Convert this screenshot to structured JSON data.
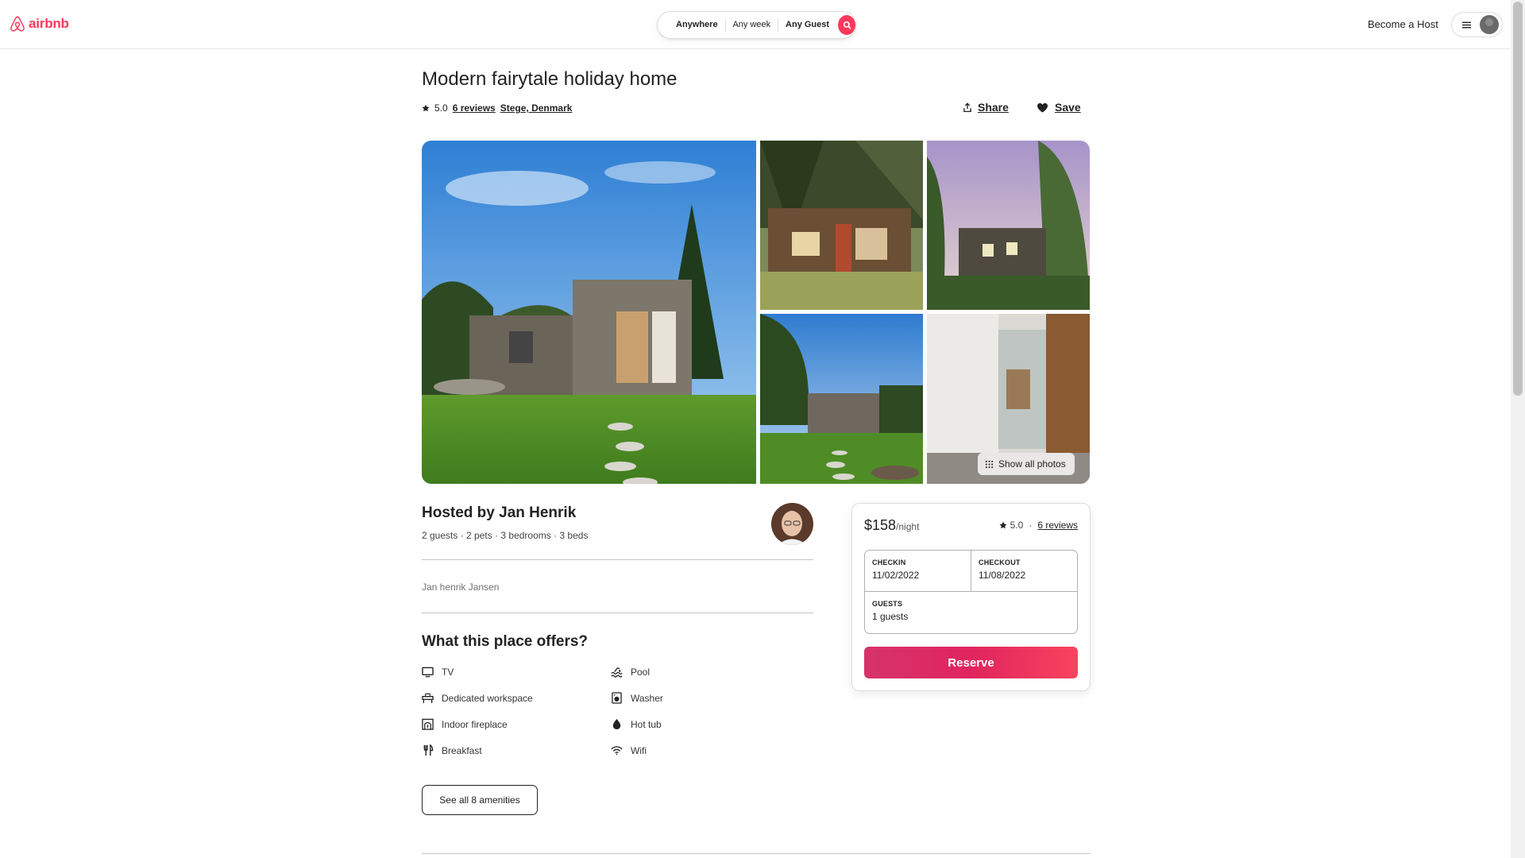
{
  "header": {
    "logo_text": "airbnb",
    "search": {
      "where": "Anywhere",
      "when": "Any week",
      "who": "Any Guest"
    },
    "become_host": "Become a Host"
  },
  "listing": {
    "title": "Modern fairytale holiday home",
    "rating": "5.0",
    "reviews_link": "6 reviews",
    "location": "Stege, Denmark",
    "share_label": "Share",
    "save_label": "Save",
    "show_all_photos": "Show all photos"
  },
  "host": {
    "hosted_by": "Hosted by Jan Henrik",
    "details": "2 guests · 2 pets · 3 bedrooms · 3 beds",
    "full_name": "Jan henrik Jansen"
  },
  "amenities": {
    "title": "What this place offers?",
    "items": [
      {
        "label": "TV",
        "icon": "tv-icon"
      },
      {
        "label": "Pool",
        "icon": "pool-icon"
      },
      {
        "label": "Dedicated workspace",
        "icon": "workspace-icon"
      },
      {
        "label": "Washer",
        "icon": "washer-icon"
      },
      {
        "label": "Indoor fireplace",
        "icon": "fireplace-icon"
      },
      {
        "label": "Hot tub",
        "icon": "hot-tub-icon"
      },
      {
        "label": "Breakfast",
        "icon": "breakfast-icon"
      },
      {
        "label": "Wifi",
        "icon": "wifi-icon"
      }
    ],
    "see_all_label": "See all 8 amenities"
  },
  "booking": {
    "price": "$158",
    "per_night": "/night",
    "rating": "5.0",
    "separator": "·",
    "reviews_link": "6 reviews",
    "checkin_label": "CHECKIN",
    "checkin_value": "11/02/2022",
    "checkout_label": "CHECKOUT",
    "checkout_value": "11/08/2022",
    "guests_label": "GUESTS",
    "guests_value": "1 guests",
    "reserve_label": "Reserve"
  },
  "colors": {
    "brand": "#ff385c",
    "reserve_gradient_start": "#d6336c",
    "reserve_gradient_end": "#f7445e"
  }
}
